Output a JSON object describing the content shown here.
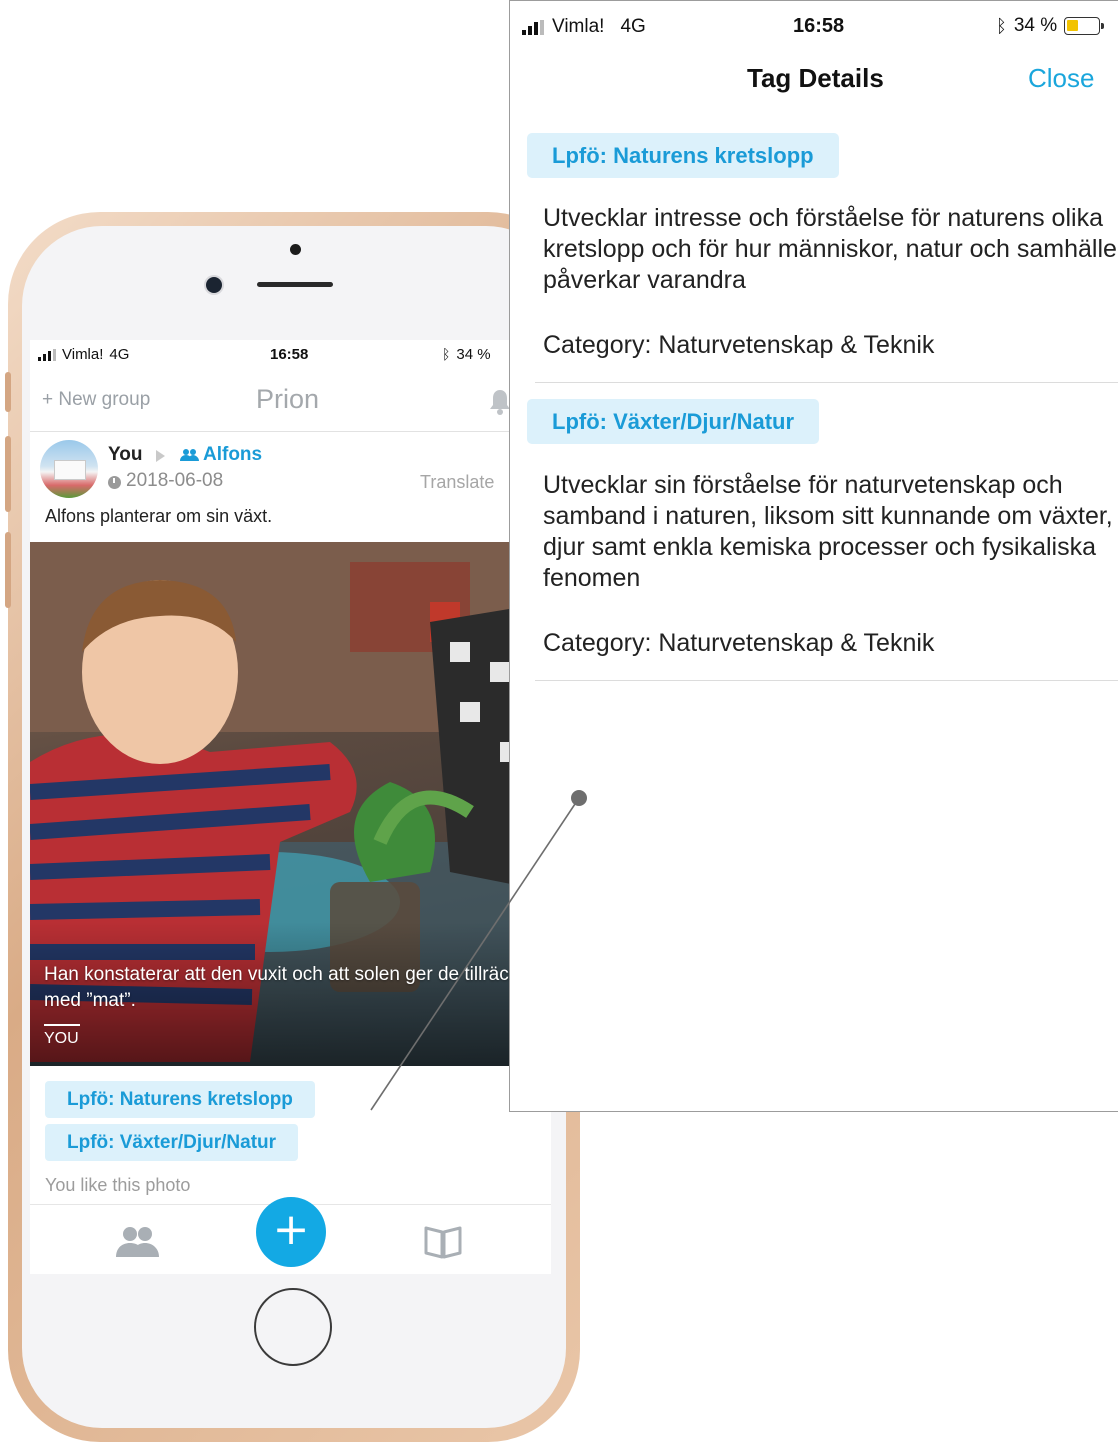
{
  "phone": {
    "status_bar": {
      "carrier": "Vimla!",
      "network": "4G",
      "time": "16:58",
      "battery": "34 %"
    },
    "header": {
      "new_group": "New group",
      "title": "Prion"
    },
    "post": {
      "author": "You",
      "group": "Alfons",
      "date": "2018-06-08",
      "translate": "Translate",
      "text": "Alfons planterar om sin växt.",
      "caption": "Han konstaterar att den vuxit och att solen ger de tillräckligt med ”mat”.",
      "caption_author": "YOU",
      "tags": [
        "Lpfö: Naturens kretslopp",
        "Lpfö: Växter/Djur/Natur"
      ],
      "like_text": "You like this photo"
    },
    "tabbar": {
      "add": "+"
    }
  },
  "panel": {
    "status_bar": {
      "carrier": "Vimla!",
      "network": "4G",
      "time": "16:58",
      "battery": "34 %"
    },
    "title": "Tag Details",
    "close": "Close",
    "tags": [
      {
        "name": "Lpfö: Naturens kretslopp",
        "description": "Utvecklar intresse och förståelse för naturens olika kretslopp och för hur människor, natur och samhälle påverkar varandra",
        "category": "Category: Naturvetenskap & Teknik"
      },
      {
        "name": "Lpfö: Växter/Djur/Natur",
        "description": "Utvecklar sin förståelse för naturvetenskap och samband i naturen, liksom sitt kunnande om växter, djur samt enkla kemiska processer och fysikaliska fenomen",
        "category": "Category: Naturvetenskap & Teknik"
      }
    ]
  },
  "colors": {
    "accent": "#1a9bd7",
    "fab": "#13a9e4",
    "tag_bg": "#dcf1fb"
  }
}
